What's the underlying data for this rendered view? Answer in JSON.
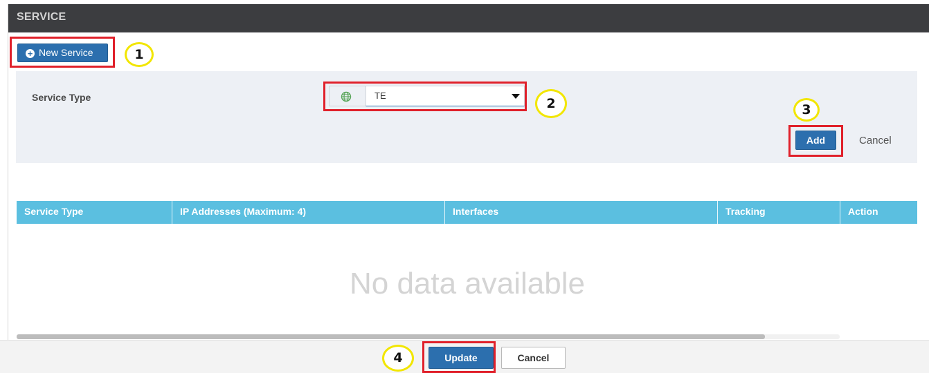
{
  "panel": {
    "title": "SERVICE"
  },
  "toolbar": {
    "new_service_label": "New Service"
  },
  "form": {
    "service_type_label": "Service Type",
    "service_type_value": "TE",
    "add_label": "Add",
    "cancel_label": "Cancel"
  },
  "table": {
    "columns": [
      "Service Type",
      "IP Addresses (Maximum: 4)",
      "Interfaces",
      "Tracking",
      "Action"
    ],
    "empty_message": "No data available"
  },
  "footer": {
    "update_label": "Update",
    "cancel_label": "Cancel"
  },
  "annotations": [
    "1",
    "2",
    "3",
    "4"
  ],
  "colors": {
    "header_bg": "#3c3d40",
    "primary": "#2c6fae",
    "table_header": "#5bbfe0",
    "highlight": "#e0202a",
    "callout": "#f2e600"
  }
}
